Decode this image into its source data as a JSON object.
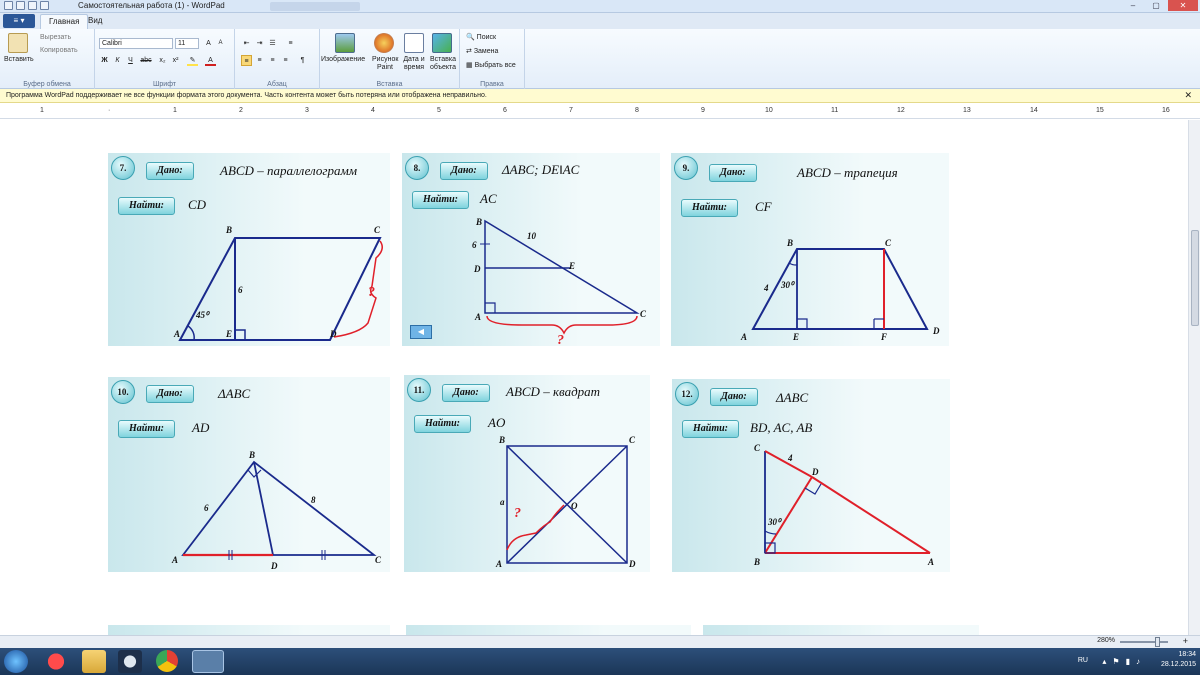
{
  "window": {
    "title": "Самостоятельная работа (1) - WordPad",
    "controls": [
      "–",
      "▢",
      "✕"
    ]
  },
  "tabs": {
    "file": "≡ ▾",
    "home": "Главная",
    "view": "Вид"
  },
  "ribbon": {
    "clipboard": {
      "paste": "Вставить",
      "cut": "Вырезать",
      "copy": "Копировать",
      "label": "Буфер обмена"
    },
    "font": {
      "family": "Calibri",
      "size": "11",
      "grow": "A",
      "shrink": "A",
      "bold": "Ж",
      "italic": "К",
      "underline": "Ч",
      "strike": "abc",
      "sub": "x₂",
      "sup": "x²",
      "label": "Шрифт"
    },
    "paragraph": {
      "label": "Абзац"
    },
    "insert": {
      "image": "Изображение",
      "paint": "Рисунок Paint",
      "datetime": "Дата и время",
      "object": "Вставка объекта",
      "label": "Вставка"
    },
    "editing": {
      "find": "Поиск",
      "replace": "Замена",
      "selectall": "Выбрать все",
      "label": "Правка"
    }
  },
  "infobar": {
    "text": "Программа WordPad поддерживает не все функции формата этого документа. Часть контента может быть потеряна или отображена неправильно.",
    "close": "✕"
  },
  "ruler": {
    "marks": [
      "1",
      "·",
      "1",
      "2",
      "3",
      "4",
      "5",
      "6",
      "7",
      "8",
      "9",
      "10",
      "11",
      "12",
      "13",
      "14",
      "15",
      "16"
    ]
  },
  "cards": [
    {
      "num": "7.",
      "given_label": "Дано:",
      "given": "ABCD – параллелограмм",
      "find_label": "Найти:",
      "find": "CD",
      "pts": {
        "B": "B",
        "C": "C",
        "A": "A",
        "E": "E",
        "D": "D"
      },
      "side": "6",
      "angle": "45⁰",
      "q": "?"
    },
    {
      "num": "8.",
      "given_label": "Дано:",
      "given": "ΔABC;  DEǁAC",
      "find_label": "Найти:",
      "find": "AC",
      "pts": {
        "B": "B",
        "D": "D",
        "E": "E",
        "A": "A",
        "C": "C"
      },
      "n10": "10",
      "n6": "6",
      "q": "?",
      "back": "◀"
    },
    {
      "num": "9.",
      "given_label": "Дано:",
      "given": "ABCD – трапеция",
      "find_label": "Найти:",
      "find": "CF",
      "pts": {
        "B": "B",
        "C": "C",
        "A": "A",
        "E": "E",
        "F": "F",
        "D": "D"
      },
      "side": "4",
      "angle": "30⁰"
    },
    {
      "num": "10.",
      "given_label": "Дано:",
      "given": "ΔABC",
      "find_label": "Найти:",
      "find": "AD",
      "pts": {
        "B": "B",
        "A": "A",
        "D": "D",
        "C": "C"
      },
      "n6": "6",
      "n8": "8"
    },
    {
      "num": "11.",
      "given_label": "Дано:",
      "given": "ABCD – квадрат",
      "find_label": "Найти:",
      "find": "AO",
      "pts": {
        "B": "B",
        "C": "C",
        "O": "O",
        "A": "A",
        "D": "D"
      },
      "a": "a",
      "q": "?"
    },
    {
      "num": "12.",
      "given_label": "Дано:",
      "given": "ΔABC",
      "find_label": "Найти:",
      "find": "BD,  AC,  AB",
      "pts": {
        "C": "C",
        "D": "D",
        "B": "B",
        "A": "A"
      },
      "n4": "4",
      "angle": "30⁰"
    }
  ],
  "statusbar": {
    "zoom": "280%",
    "minus": "–",
    "plus": "+"
  },
  "taskbar": {
    "lang": "RU",
    "time": "18:34",
    "date": "28.12.2015"
  },
  "colors": {
    "blue": "#1a2a8c",
    "red": "#e0202a",
    "accent": "#5fc1cf"
  }
}
